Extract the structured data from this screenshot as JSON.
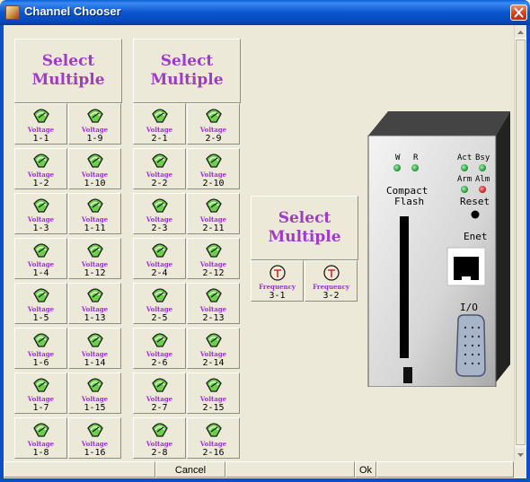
{
  "window": {
    "title": "Channel Chooser"
  },
  "groups": [
    {
      "select_label": "Select\nMultiple",
      "channels": [
        {
          "kind": "Voltage",
          "num": "1-1"
        },
        {
          "kind": "Voltage",
          "num": "1-9"
        },
        {
          "kind": "Voltage",
          "num": "1-2"
        },
        {
          "kind": "Voltage",
          "num": "1-10"
        },
        {
          "kind": "Voltage",
          "num": "1-3"
        },
        {
          "kind": "Voltage",
          "num": "1-11"
        },
        {
          "kind": "Voltage",
          "num": "1-4"
        },
        {
          "kind": "Voltage",
          "num": "1-12"
        },
        {
          "kind": "Voltage",
          "num": "1-5"
        },
        {
          "kind": "Voltage",
          "num": "1-13"
        },
        {
          "kind": "Voltage",
          "num": "1-6"
        },
        {
          "kind": "Voltage",
          "num": "1-14"
        },
        {
          "kind": "Voltage",
          "num": "1-7"
        },
        {
          "kind": "Voltage",
          "num": "1-15"
        },
        {
          "kind": "Voltage",
          "num": "1-8"
        },
        {
          "kind": "Voltage",
          "num": "1-16"
        }
      ]
    },
    {
      "select_label": "Select\nMultiple",
      "channels": [
        {
          "kind": "Voltage",
          "num": "2-1"
        },
        {
          "kind": "Voltage",
          "num": "2-9"
        },
        {
          "kind": "Voltage",
          "num": "2-2"
        },
        {
          "kind": "Voltage",
          "num": "2-10"
        },
        {
          "kind": "Voltage",
          "num": "2-3"
        },
        {
          "kind": "Voltage",
          "num": "2-11"
        },
        {
          "kind": "Voltage",
          "num": "2-4"
        },
        {
          "kind": "Voltage",
          "num": "2-12"
        },
        {
          "kind": "Voltage",
          "num": "2-5"
        },
        {
          "kind": "Voltage",
          "num": "2-13"
        },
        {
          "kind": "Voltage",
          "num": "2-6"
        },
        {
          "kind": "Voltage",
          "num": "2-14"
        },
        {
          "kind": "Voltage",
          "num": "2-7"
        },
        {
          "kind": "Voltage",
          "num": "2-15"
        },
        {
          "kind": "Voltage",
          "num": "2-8"
        },
        {
          "kind": "Voltage",
          "num": "2-16"
        }
      ]
    },
    {
      "select_label": "Select\nMultiple",
      "channels": [
        {
          "kind": "Frequency",
          "num": "3-1"
        },
        {
          "kind": "Frequency",
          "num": "3-2"
        }
      ]
    }
  ],
  "device": {
    "led_labels": [
      "W",
      "R"
    ],
    "status_labels": [
      "Act",
      "Bsy",
      "Arm",
      "Alm"
    ],
    "compact_flash": "Compact\nFlash",
    "reset": "Reset",
    "enet": "Enet",
    "io": "I/O"
  },
  "bottom": {
    "cancel": "Cancel",
    "ok": "Ok"
  },
  "icons": {
    "voltage": "voltage-gauge-icon",
    "frequency": "frequency-dial-icon"
  },
  "colors": {
    "title_bar": "#0a55d0",
    "label_purple": "#a03ac8",
    "led_green": "#1fa040",
    "led_red": "#d02020",
    "voltage_icon_green": "#6cd04a"
  }
}
